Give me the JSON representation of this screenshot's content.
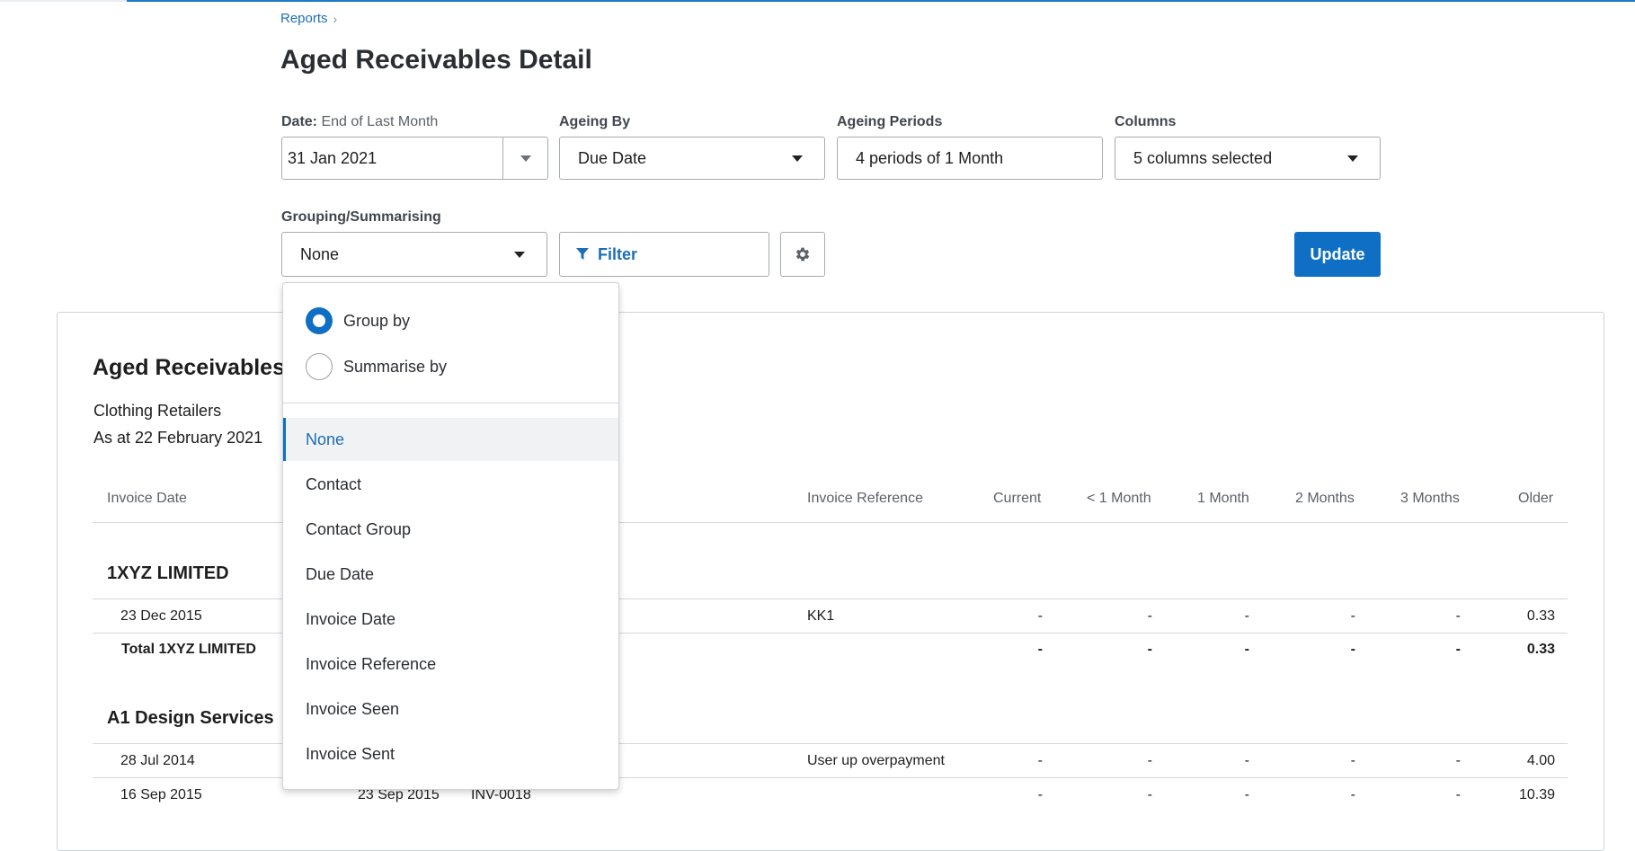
{
  "breadcrumb": {
    "link": "Reports",
    "sep": "›"
  },
  "page_title": "Aged Receivables Detail",
  "filters": {
    "date_label": "Date:",
    "date_sub": "End of Last Month",
    "date_value": "31 Jan 2021",
    "ageing_by_label": "Ageing By",
    "ageing_by_value": "Due Date",
    "ageing_periods_label": "Ageing Periods",
    "ageing_periods_value": "4 periods of 1 Month",
    "columns_label": "Columns",
    "columns_value": "5 columns selected",
    "grouping_label": "Grouping/Summarising",
    "grouping_value": "None",
    "filter_label": "Filter",
    "update_label": "Update"
  },
  "report": {
    "title": "Aged Receivables",
    "org": "Clothing Retailers",
    "as_at": "As at 22 February 2021",
    "columns": [
      "Invoice Date",
      "Invoice Reference",
      "Current",
      "< 1 Month",
      "1 Month",
      "2 Months",
      "3 Months",
      "Older"
    ],
    "groups": [
      {
        "name": "1XYZ LIMITED",
        "row": {
          "date": "23 Dec 2015",
          "ref": "KK1",
          "vals": [
            "-",
            "-",
            "-",
            "-",
            "-",
            "0.33"
          ]
        },
        "total_label": "Total 1XYZ LIMITED",
        "total_vals": [
          "-",
          "-",
          "-",
          "-",
          "-",
          "0.33"
        ]
      },
      {
        "name": "A1 Design Services",
        "rows": [
          {
            "date": "28 Jul 2014",
            "ref": "User up overpayment",
            "vals": [
              "-",
              "-",
              "-",
              "-",
              "-",
              "4.00"
            ]
          },
          {
            "date": "16 Sep 2015",
            "due": "23 Sep 2015",
            "num": "INV-0018",
            "vals": [
              "-",
              "-",
              "-",
              "-",
              "-",
              "10.39"
            ]
          }
        ]
      }
    ]
  },
  "dropdown": {
    "group_by": "Group by",
    "summarise_by": "Summarise by",
    "options": [
      "None",
      "Contact",
      "Contact Group",
      "Due Date",
      "Invoice Date",
      "Invoice Reference",
      "Invoice Seen",
      "Invoice Sent"
    ]
  },
  "colors": {
    "accent": "#0f6fc5",
    "link": "#1c6fb5"
  }
}
